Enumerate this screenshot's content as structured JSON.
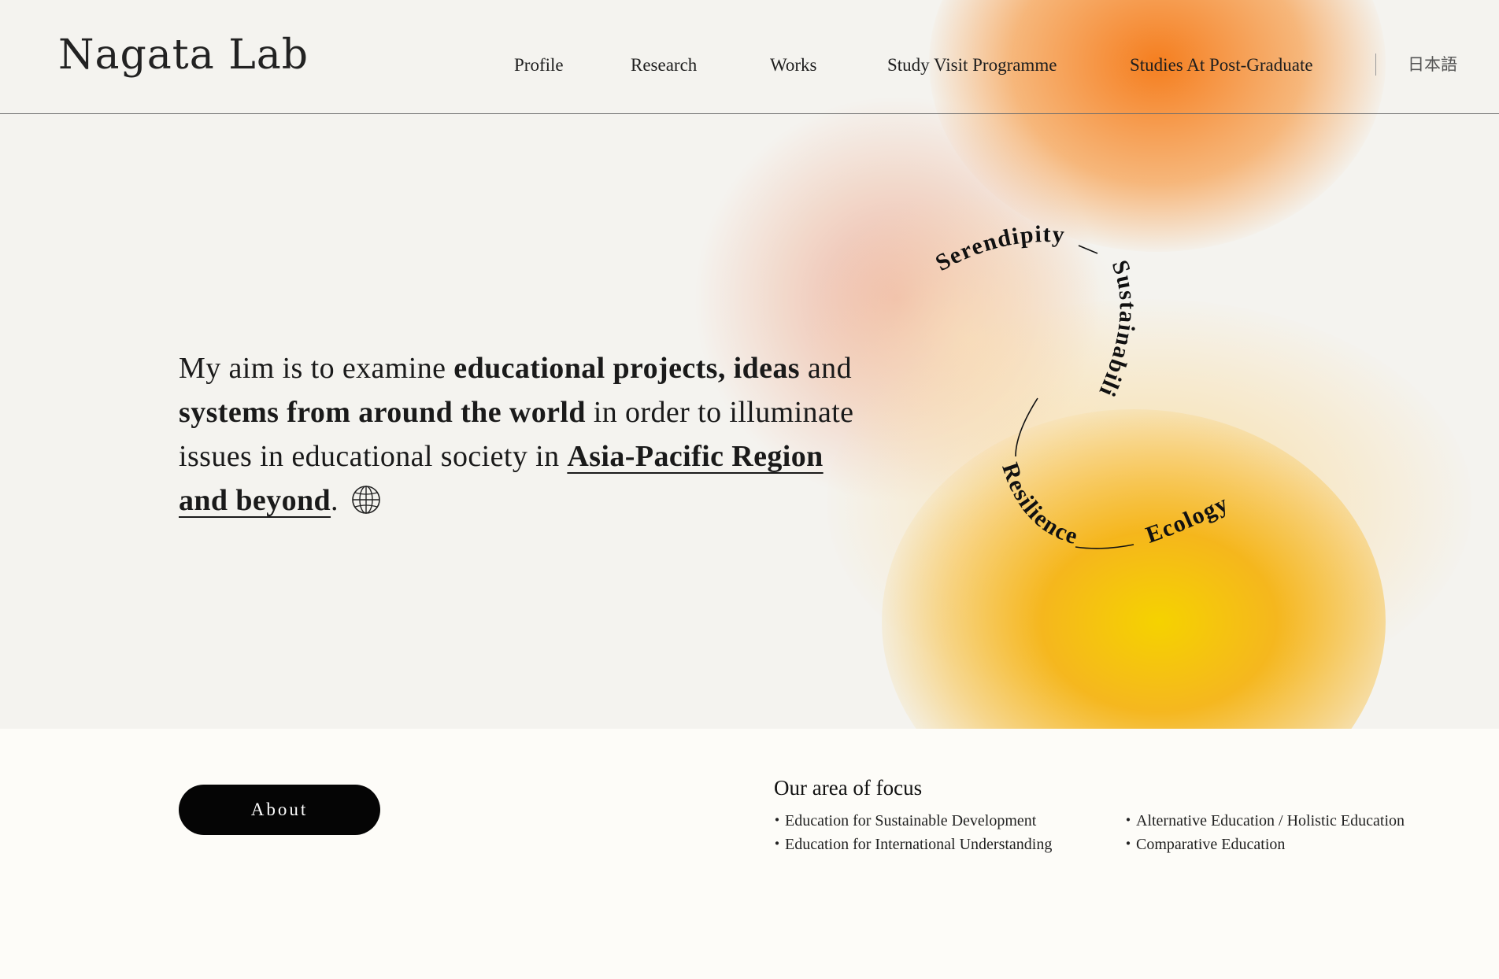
{
  "header": {
    "logo": "Nagata Lab",
    "nav": [
      "Profile",
      "Research",
      "Works",
      "Study Visit Programme",
      "Studies At Post-Graduate"
    ],
    "language": "日本語"
  },
  "hero": {
    "aim": {
      "p1": "My aim is to examine ",
      "b1": "educational projects, ideas",
      "p2": " and ",
      "b2": "systems from around the world",
      "p3": " in order to illuminate issues in educational society in ",
      "link": "Asia-Pacific Region and beyond",
      "p4": "."
    },
    "ring_words": [
      "Serendipity",
      "Sustainability",
      "Resilience",
      "Ecology"
    ]
  },
  "about": {
    "button": "About"
  },
  "focus": {
    "title": "Our area of focus",
    "col1": [
      "Education for Sustainable Development",
      "Education for International Understanding"
    ],
    "col2": [
      "Alternative Education / Holistic Education",
      "Comparative Education"
    ]
  },
  "colors": {
    "accent_orange": "#f57814",
    "accent_yellow": "#f5d200",
    "background": "#f4f3ef",
    "button": "#050505"
  }
}
